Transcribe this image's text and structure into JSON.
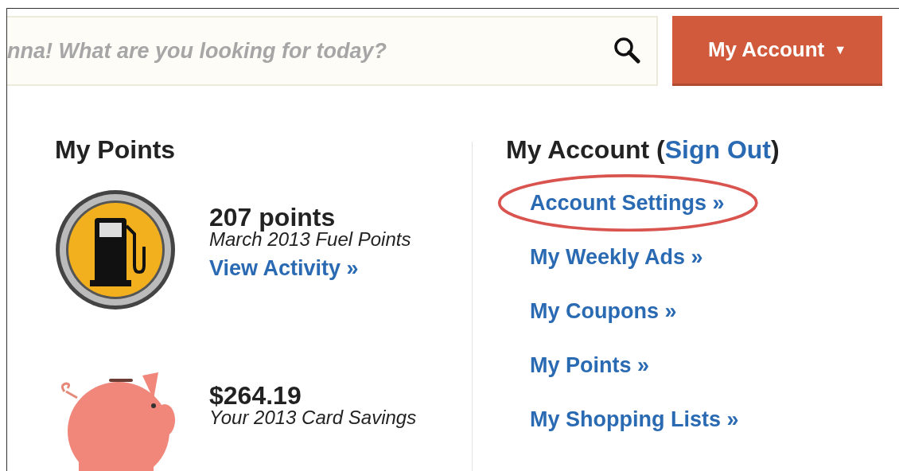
{
  "search": {
    "placeholder": "nna! What are you looking for today?"
  },
  "account_button": {
    "label": "My Account",
    "caret": "▼"
  },
  "points_panel": {
    "title": "My Points",
    "items": [
      {
        "kind": "fuel",
        "amount": "207 points",
        "caption": "March 2013 Fuel Points",
        "link": "View Activity »"
      },
      {
        "kind": "savings",
        "amount": "$264.19",
        "caption": "Your 2013 Card Savings"
      }
    ]
  },
  "account_panel": {
    "title_before": "My Account (",
    "sign_out": "Sign Out",
    "title_after": ")",
    "links": [
      {
        "label": "Account Settings »",
        "circled": true
      },
      {
        "label": "My Weekly Ads »",
        "circled": false
      },
      {
        "label": "My Coupons »",
        "circled": false
      },
      {
        "label": "My Points »",
        "circled": false
      },
      {
        "label": "My Shopping Lists »",
        "circled": false
      }
    ]
  }
}
